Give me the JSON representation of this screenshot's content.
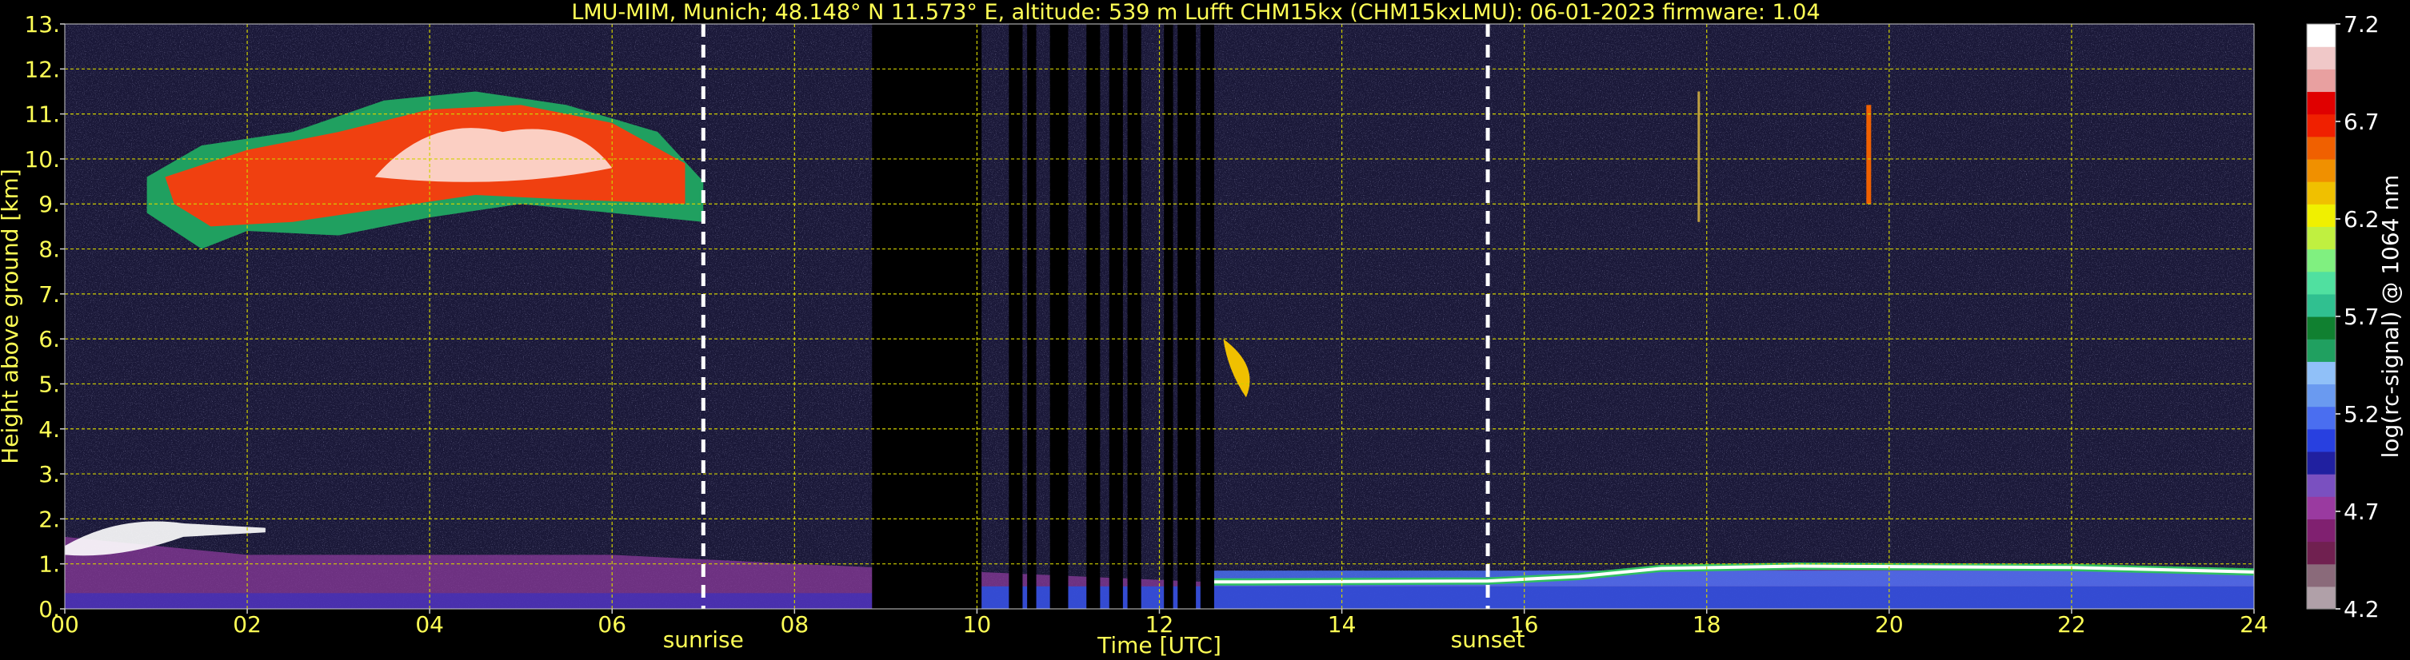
{
  "title": "LMU-MIM, Munich; 48.148° N 11.573° E, altitude: 539 m    Lufft CHM15kx (CHM15kxLMU): 06-01-2023    firmware: 1.04",
  "chart_data": {
    "type": "heatmap",
    "xlabel": "Time [UTC]",
    "ylabel": "Height above ground [km]",
    "xlim": [
      0,
      24
    ],
    "ylim": [
      0,
      13
    ],
    "x_ticks": [
      "00",
      "02",
      "04",
      "06",
      "08",
      "10",
      "12",
      "14",
      "16",
      "18",
      "20",
      "22",
      "24"
    ],
    "y_ticks": [
      "0.",
      "1.",
      "2.",
      "3.",
      "4.",
      "5.",
      "6.",
      "7.",
      "8.",
      "9.",
      "10.",
      "11.",
      "12.",
      "13."
    ],
    "grid": true,
    "colorbar": {
      "label": "log(rc-signal) @ 1064 nm",
      "range": [
        4.2,
        7.2
      ],
      "ticks": [
        "4.2",
        "4.7",
        "5.2",
        "5.7",
        "6.2",
        "6.7",
        "7.2"
      ],
      "colors": [
        "#b0a0a8",
        "#8a6a7a",
        "#702050",
        "#802070",
        "#9a3aa0",
        "#7a50c0",
        "#2020a0",
        "#2840e0",
        "#4a6ef0",
        "#6a9af0",
        "#90c0f8",
        "#20a060",
        "#108030",
        "#30c090",
        "#50e0a0",
        "#80f080",
        "#c0f040",
        "#f0f000",
        "#f0c000",
        "#f09000",
        "#f06000",
        "#f02000",
        "#e00000",
        "#e8a0a0",
        "#f0c8c8",
        "#ffffff"
      ]
    },
    "markers": [
      {
        "label": "sunrise",
        "x": 7.0
      },
      {
        "label": "sunset",
        "x": 15.6
      }
    ],
    "features": {
      "cirrus": {
        "x": [
          0.9,
          7.0
        ],
        "height_km": [
          8.0,
          11.5
        ]
      },
      "no_data_gaps": [
        [
          8.85,
          10.05
        ],
        [
          10.35,
          10.5
        ],
        [
          10.55,
          10.65
        ],
        [
          10.8,
          11.0
        ],
        [
          11.2,
          11.35
        ],
        [
          11.45,
          11.6
        ],
        [
          11.65,
          11.8
        ],
        [
          12.05,
          12.15
        ],
        [
          12.2,
          12.4
        ],
        [
          12.45,
          12.6
        ]
      ],
      "boundary_layer_top_km": [
        [
          0,
          1.6
        ],
        [
          1,
          1.4
        ],
        [
          2,
          1.2
        ],
        [
          6,
          1.2
        ],
        [
          8,
          1.0
        ],
        [
          12.5,
          0.6
        ],
        [
          13,
          0.6
        ],
        [
          15.6,
          0.6
        ],
        [
          16.6,
          0.7
        ],
        [
          17.5,
          0.9
        ],
        [
          19,
          0.95
        ],
        [
          22,
          0.9
        ],
        [
          24,
          0.8
        ]
      ]
    }
  }
}
